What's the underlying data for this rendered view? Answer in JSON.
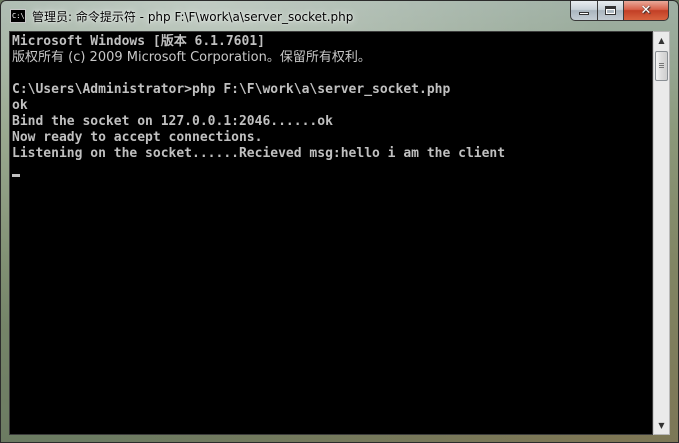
{
  "window": {
    "title": "管理员: 命令提示符 - php  F:\\F\\work\\a\\server_socket.php",
    "app_icon_text": "C:\\"
  },
  "console": {
    "lines": [
      "Microsoft Windows [版本 6.1.7601]",
      "版权所有 (c) 2009 Microsoft Corporation。保留所有权利。",
      "",
      "C:\\Users\\Administrator>php F:\\F\\work\\a\\server_socket.php",
      "ok",
      "Bind the socket on 127.0.0.1:2046......ok",
      "Now ready to accept connections.",
      "Listening on the socket......Recieved msg:hello i am the client"
    ]
  },
  "caption": {
    "close_label": "✕"
  },
  "colors": {
    "console_background": "#000000",
    "console_text": "#c0c0c0",
    "close_button": "#c94a30"
  },
  "icons": {
    "minimize": "minimize-icon",
    "maximize": "maximize-icon",
    "close": "close-icon",
    "scroll_up": "scroll-up-arrow-icon",
    "scroll_down": "scroll-down-arrow-icon"
  }
}
